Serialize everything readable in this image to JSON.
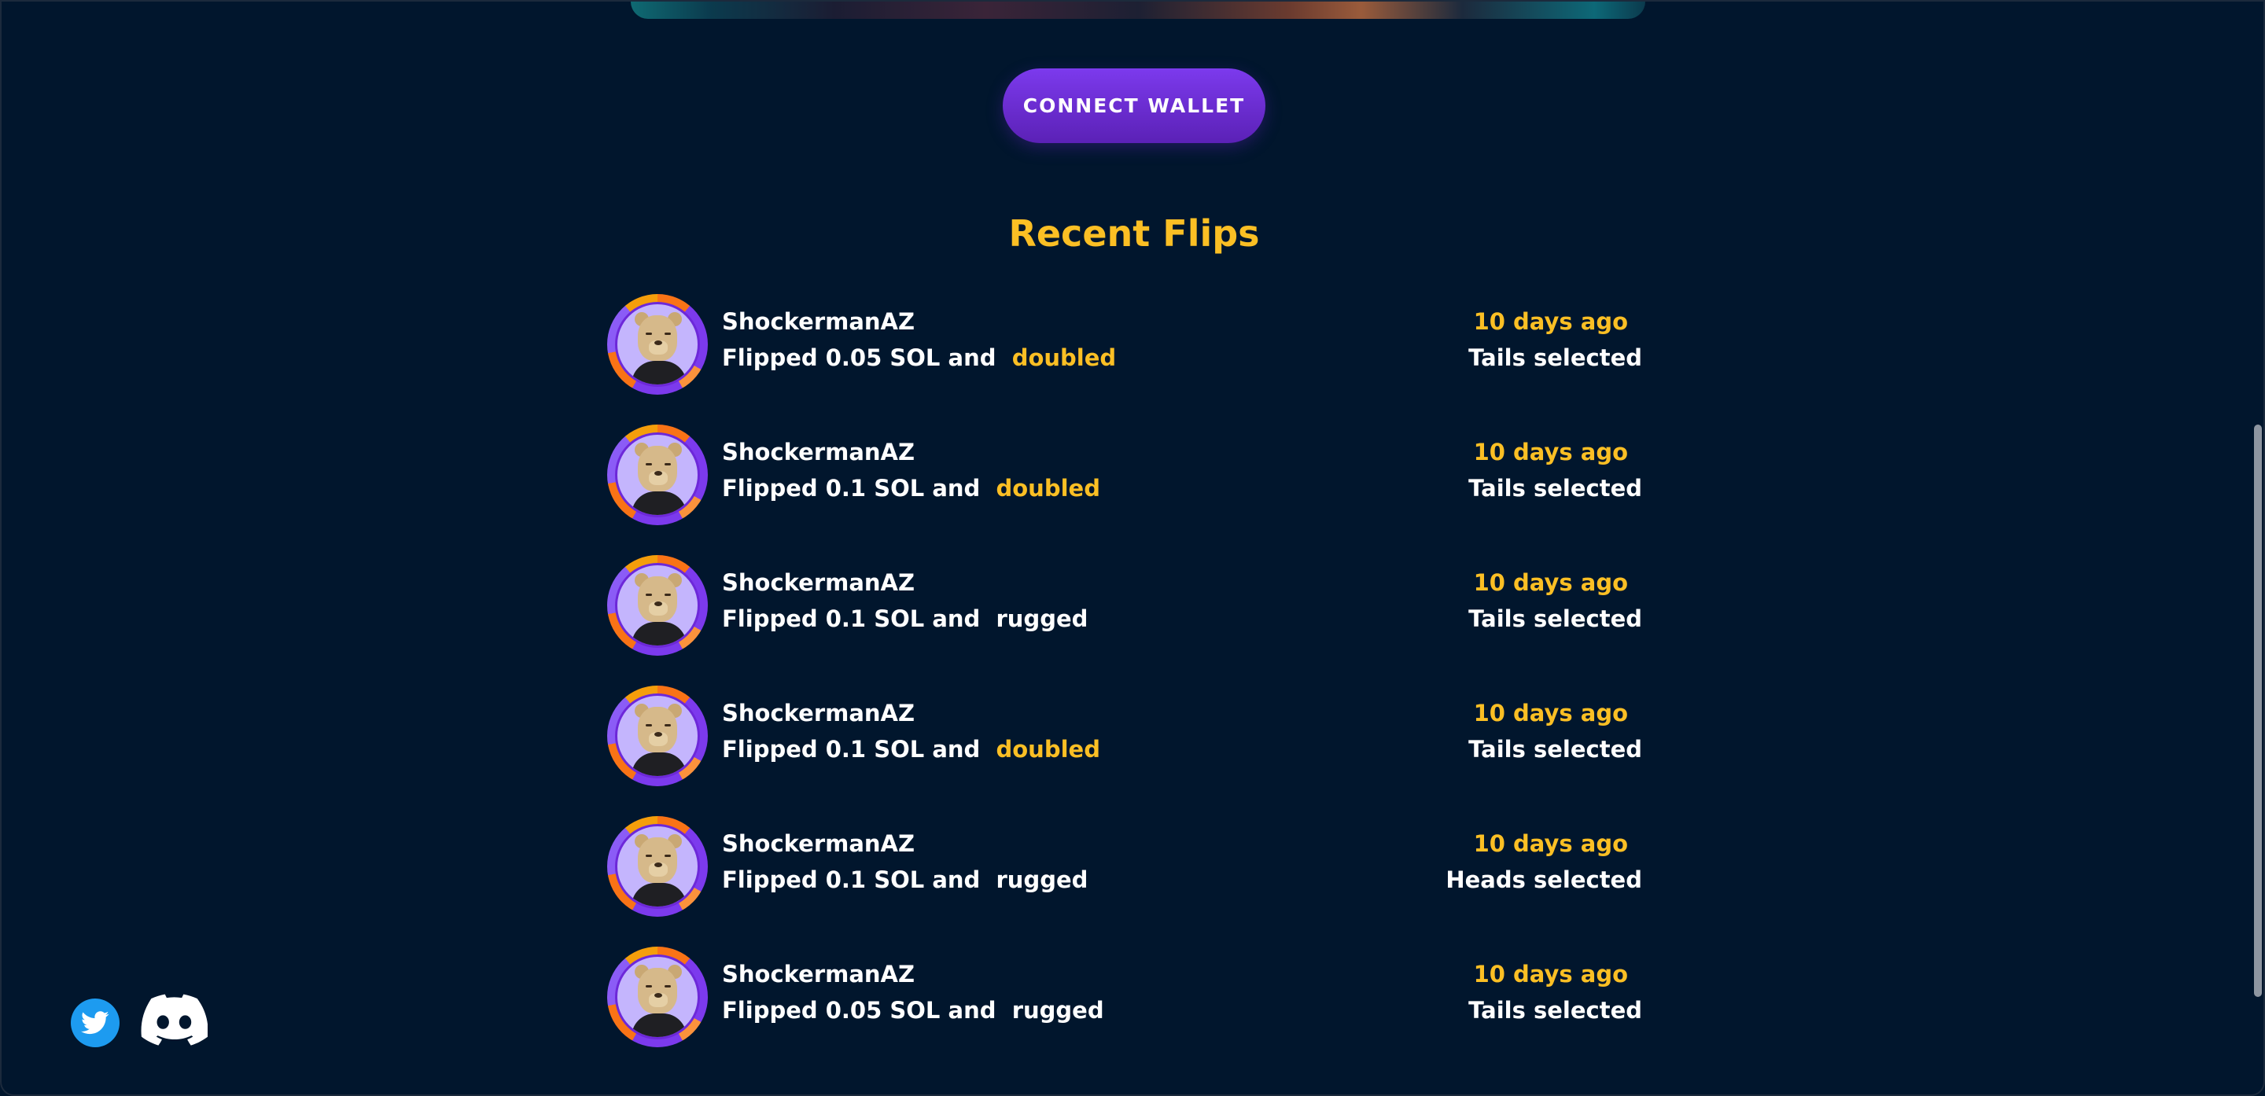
{
  "header": {
    "connect_wallet_label": "CONNECT WALLET"
  },
  "recent": {
    "title": "Recent Flips",
    "items": [
      {
        "user": "ShockermanAZ",
        "prefix": "Flipped 0.05 SOL and ",
        "outcome": "doubled",
        "time": "10 days ago",
        "side": "Tails selected"
      },
      {
        "user": "ShockermanAZ",
        "prefix": "Flipped 0.1 SOL and ",
        "outcome": "doubled",
        "time": "10 days ago",
        "side": "Tails selected"
      },
      {
        "user": "ShockermanAZ",
        "prefix": "Flipped 0.1 SOL and ",
        "outcome": "rugged",
        "time": "10 days ago",
        "side": "Tails selected"
      },
      {
        "user": "ShockermanAZ",
        "prefix": "Flipped 0.1 SOL and ",
        "outcome": "doubled",
        "time": "10 days ago",
        "side": "Tails selected"
      },
      {
        "user": "ShockermanAZ",
        "prefix": "Flipped 0.1 SOL and ",
        "outcome": "rugged",
        "time": "10 days ago",
        "side": "Heads selected"
      },
      {
        "user": "ShockermanAZ",
        "prefix": "Flipped 0.05 SOL and ",
        "outcome": "rugged",
        "time": "10 days ago",
        "side": "Tails selected"
      }
    ]
  },
  "social": {
    "icons": [
      "twitter-icon",
      "discord-icon"
    ]
  },
  "colors": {
    "background": "#01162d",
    "accent": "#fbbf24",
    "button": "#6d28d9"
  }
}
